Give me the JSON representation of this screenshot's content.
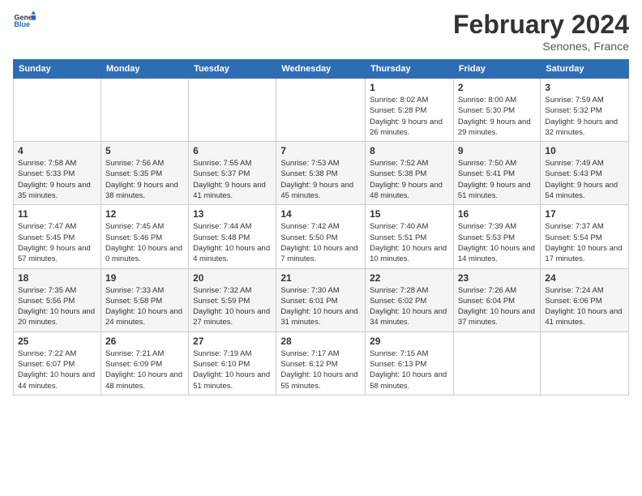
{
  "header": {
    "logo_general": "General",
    "logo_blue": "Blue",
    "month_title": "February 2024",
    "location": "Senones, France"
  },
  "weekdays": [
    "Sunday",
    "Monday",
    "Tuesday",
    "Wednesday",
    "Thursday",
    "Friday",
    "Saturday"
  ],
  "weeks": [
    [
      {
        "day": "",
        "sunrise": "",
        "sunset": "",
        "daylight": ""
      },
      {
        "day": "",
        "sunrise": "",
        "sunset": "",
        "daylight": ""
      },
      {
        "day": "",
        "sunrise": "",
        "sunset": "",
        "daylight": ""
      },
      {
        "day": "",
        "sunrise": "",
        "sunset": "",
        "daylight": ""
      },
      {
        "day": "1",
        "sunrise": "8:02 AM",
        "sunset": "5:28 PM",
        "daylight": "9 hours and 26 minutes."
      },
      {
        "day": "2",
        "sunrise": "8:00 AM",
        "sunset": "5:30 PM",
        "daylight": "9 hours and 29 minutes."
      },
      {
        "day": "3",
        "sunrise": "7:59 AM",
        "sunset": "5:32 PM",
        "daylight": "9 hours and 32 minutes."
      }
    ],
    [
      {
        "day": "4",
        "sunrise": "7:58 AM",
        "sunset": "5:33 PM",
        "daylight": "9 hours and 35 minutes."
      },
      {
        "day": "5",
        "sunrise": "7:56 AM",
        "sunset": "5:35 PM",
        "daylight": "9 hours and 38 minutes."
      },
      {
        "day": "6",
        "sunrise": "7:55 AM",
        "sunset": "5:37 PM",
        "daylight": "9 hours and 41 minutes."
      },
      {
        "day": "7",
        "sunrise": "7:53 AM",
        "sunset": "5:38 PM",
        "daylight": "9 hours and 45 minutes."
      },
      {
        "day": "8",
        "sunrise": "7:52 AM",
        "sunset": "5:38 PM",
        "daylight": "9 hours and 48 minutes."
      },
      {
        "day": "9",
        "sunrise": "7:50 AM",
        "sunset": "5:41 PM",
        "daylight": "9 hours and 51 minutes."
      },
      {
        "day": "10",
        "sunrise": "7:49 AM",
        "sunset": "5:43 PM",
        "daylight": "9 hours and 54 minutes."
      }
    ],
    [
      {
        "day": "11",
        "sunrise": "7:47 AM",
        "sunset": "5:45 PM",
        "daylight": "9 hours and 57 minutes."
      },
      {
        "day": "12",
        "sunrise": "7:45 AM",
        "sunset": "5:46 PM",
        "daylight": "10 hours and 0 minutes."
      },
      {
        "day": "13",
        "sunrise": "7:44 AM",
        "sunset": "5:48 PM",
        "daylight": "10 hours and 4 minutes."
      },
      {
        "day": "14",
        "sunrise": "7:42 AM",
        "sunset": "5:50 PM",
        "daylight": "10 hours and 7 minutes."
      },
      {
        "day": "15",
        "sunrise": "7:40 AM",
        "sunset": "5:51 PM",
        "daylight": "10 hours and 10 minutes."
      },
      {
        "day": "16",
        "sunrise": "7:39 AM",
        "sunset": "5:53 PM",
        "daylight": "10 hours and 14 minutes."
      },
      {
        "day": "17",
        "sunrise": "7:37 AM",
        "sunset": "5:54 PM",
        "daylight": "10 hours and 17 minutes."
      }
    ],
    [
      {
        "day": "18",
        "sunrise": "7:35 AM",
        "sunset": "5:56 PM",
        "daylight": "10 hours and 20 minutes."
      },
      {
        "day": "19",
        "sunrise": "7:33 AM",
        "sunset": "5:58 PM",
        "daylight": "10 hours and 24 minutes."
      },
      {
        "day": "20",
        "sunrise": "7:32 AM",
        "sunset": "5:59 PM",
        "daylight": "10 hours and 27 minutes."
      },
      {
        "day": "21",
        "sunrise": "7:30 AM",
        "sunset": "6:01 PM",
        "daylight": "10 hours and 31 minutes."
      },
      {
        "day": "22",
        "sunrise": "7:28 AM",
        "sunset": "6:02 PM",
        "daylight": "10 hours and 34 minutes."
      },
      {
        "day": "23",
        "sunrise": "7:26 AM",
        "sunset": "6:04 PM",
        "daylight": "10 hours and 37 minutes."
      },
      {
        "day": "24",
        "sunrise": "7:24 AM",
        "sunset": "6:06 PM",
        "daylight": "10 hours and 41 minutes."
      }
    ],
    [
      {
        "day": "25",
        "sunrise": "7:22 AM",
        "sunset": "6:07 PM",
        "daylight": "10 hours and 44 minutes."
      },
      {
        "day": "26",
        "sunrise": "7:21 AM",
        "sunset": "6:09 PM",
        "daylight": "10 hours and 48 minutes."
      },
      {
        "day": "27",
        "sunrise": "7:19 AM",
        "sunset": "6:10 PM",
        "daylight": "10 hours and 51 minutes."
      },
      {
        "day": "28",
        "sunrise": "7:17 AM",
        "sunset": "6:12 PM",
        "daylight": "10 hours and 55 minutes."
      },
      {
        "day": "29",
        "sunrise": "7:15 AM",
        "sunset": "6:13 PM",
        "daylight": "10 hours and 58 minutes."
      },
      {
        "day": "",
        "sunrise": "",
        "sunset": "",
        "daylight": ""
      },
      {
        "day": "",
        "sunrise": "",
        "sunset": "",
        "daylight": ""
      }
    ]
  ]
}
